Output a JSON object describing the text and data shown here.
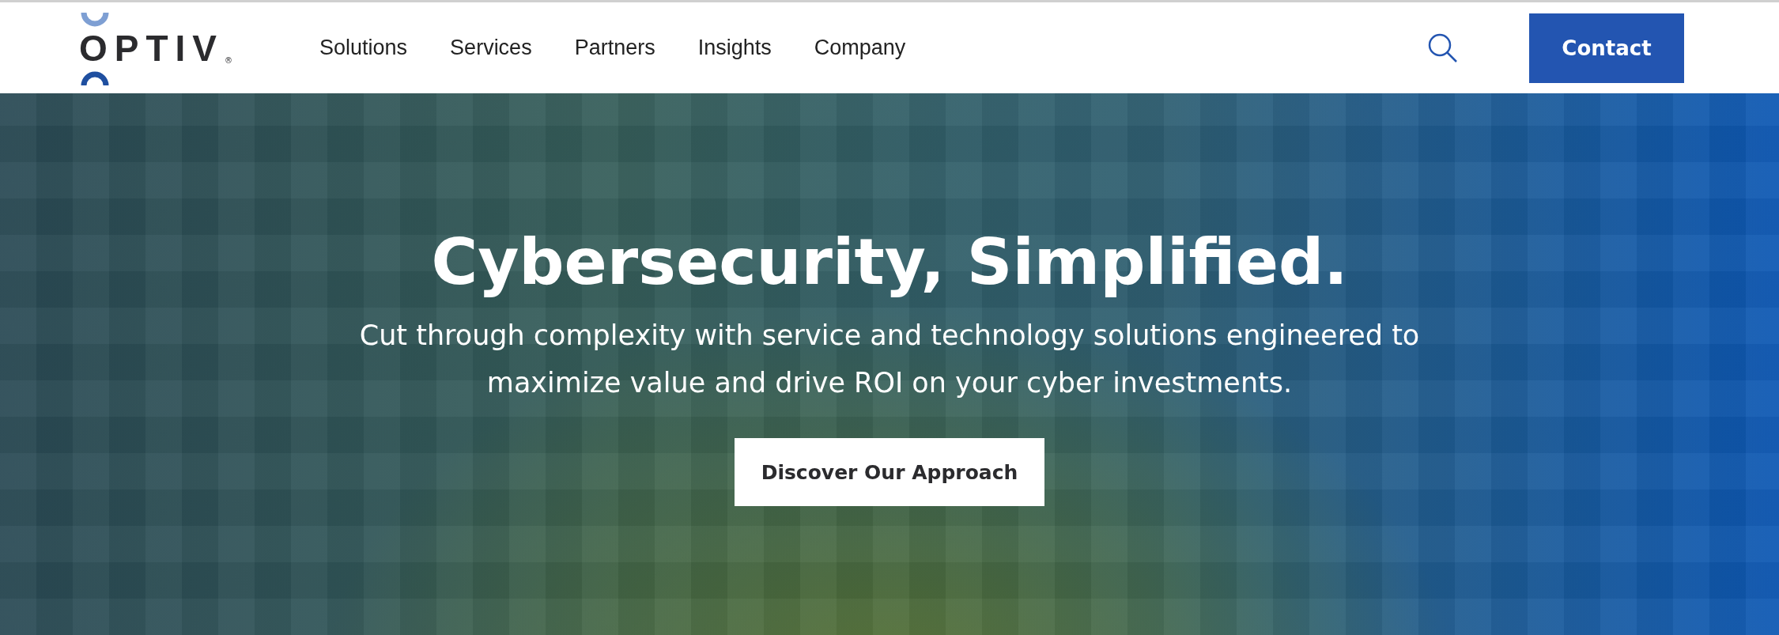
{
  "header": {
    "logo": {
      "text": "OPTIV",
      "mark": "®"
    },
    "nav": [
      {
        "label": "Solutions"
      },
      {
        "label": "Services"
      },
      {
        "label": "Partners"
      },
      {
        "label": "Insights"
      },
      {
        "label": "Company"
      }
    ],
    "contact_button": "Contact"
  },
  "hero": {
    "title": "Cybersecurity, Simplified.",
    "subtitle": "Cut through complexity with service and technology solutions engineered to maximize value and drive ROI on your cyber investments.",
    "button": "Discover Our Approach"
  }
}
